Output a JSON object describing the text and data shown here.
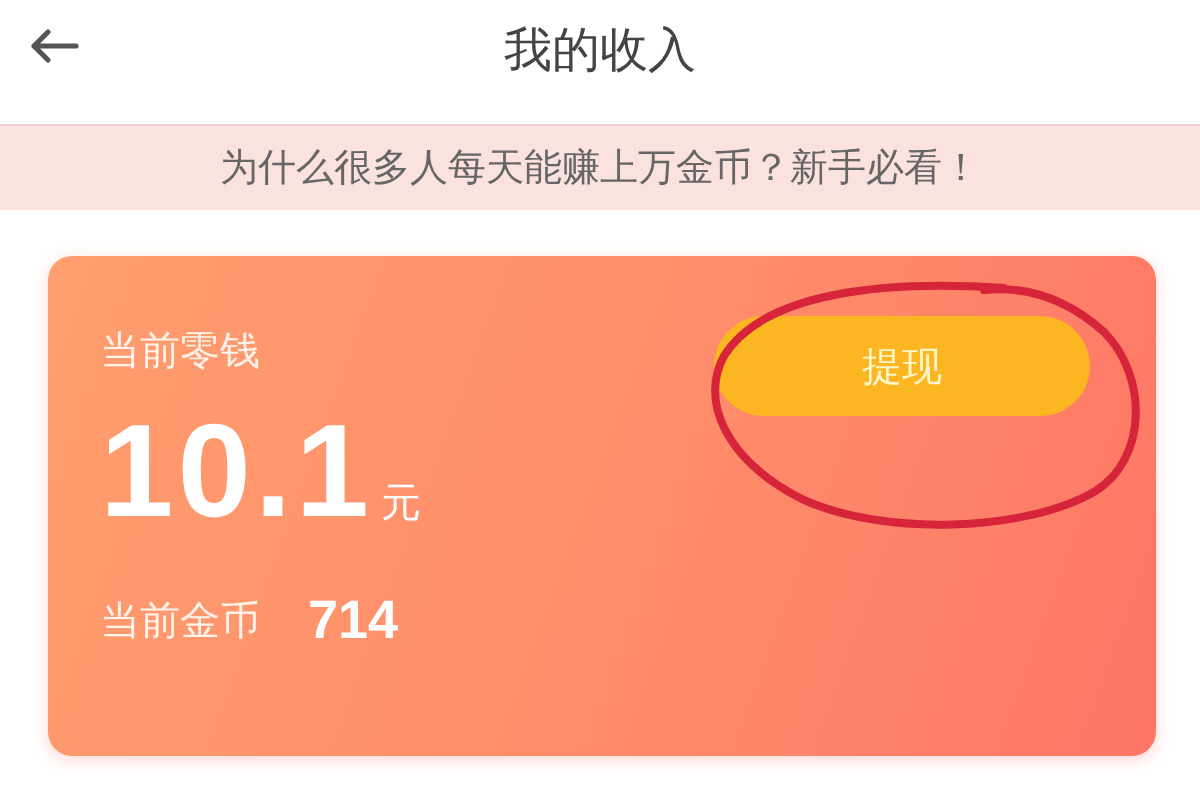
{
  "header": {
    "title": "我的收入"
  },
  "banner": {
    "text": "为什么很多人每天能赚上万金币？新手必看！"
  },
  "balance_card": {
    "change_label": "当前零钱",
    "amount": "10.1",
    "unit": "元",
    "coins_label": "当前金币",
    "coins": "714",
    "withdraw_button": {
      "label": "提现",
      "circled": true
    }
  }
}
